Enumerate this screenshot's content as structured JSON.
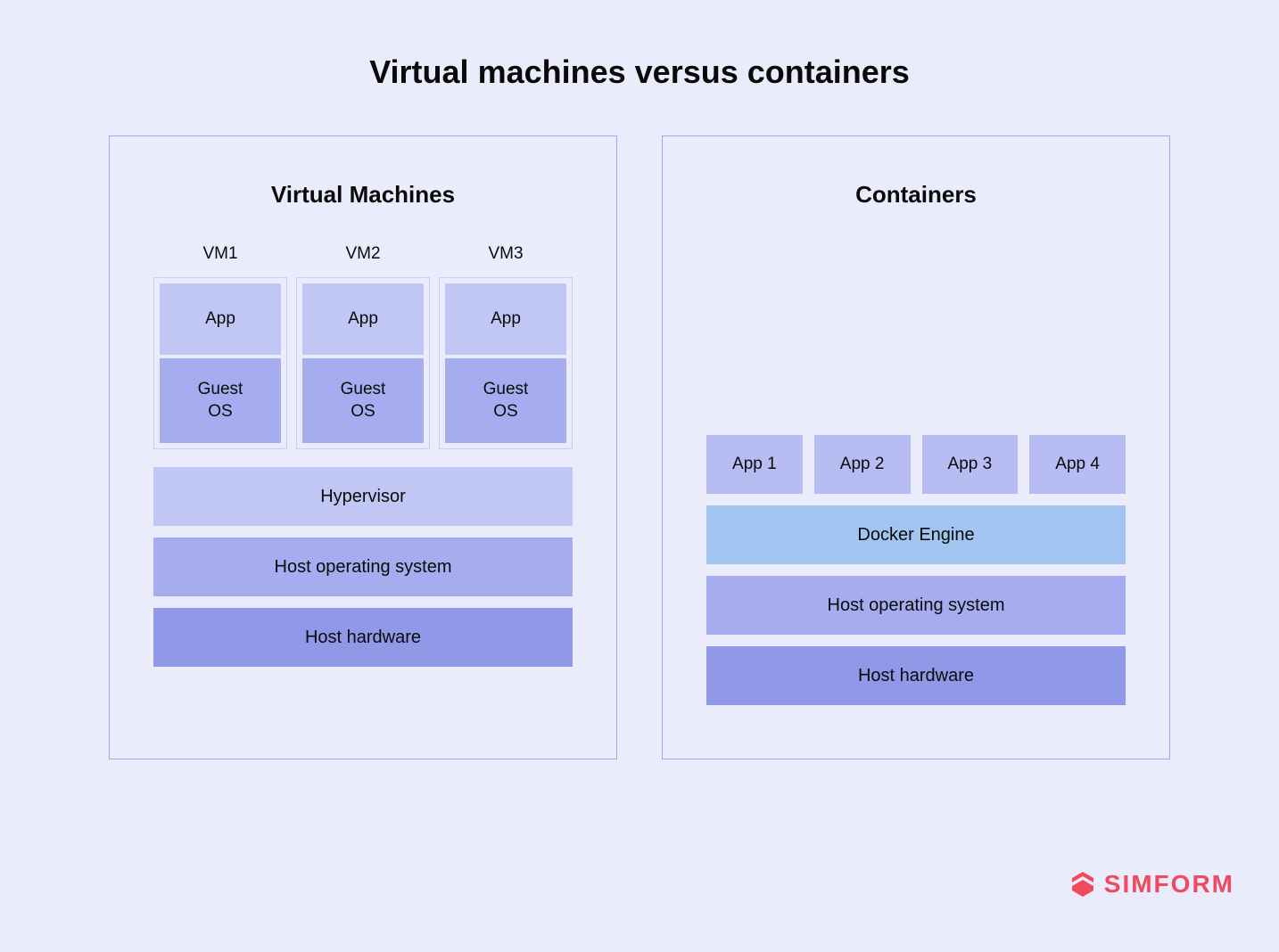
{
  "title": "Virtual machines versus containers",
  "vm_panel": {
    "title": "Virtual Machines",
    "vms": [
      {
        "label": "VM1",
        "app": "App",
        "guest": "Guest\nOS"
      },
      {
        "label": "VM2",
        "app": "App",
        "guest": "Guest\nOS"
      },
      {
        "label": "VM3",
        "app": "App",
        "guest": "Guest\nOS"
      }
    ],
    "layers": {
      "hypervisor": "Hypervisor",
      "host_os": "Host operating system",
      "host_hw": "Host hardware"
    }
  },
  "container_panel": {
    "title": "Containers",
    "apps": [
      "App 1",
      "App 2",
      "App 3",
      "App 4"
    ],
    "layers": {
      "engine": "Docker Engine",
      "host_os": "Host operating system",
      "host_hw": "Host hardware"
    }
  },
  "logo": "SIMFORM"
}
